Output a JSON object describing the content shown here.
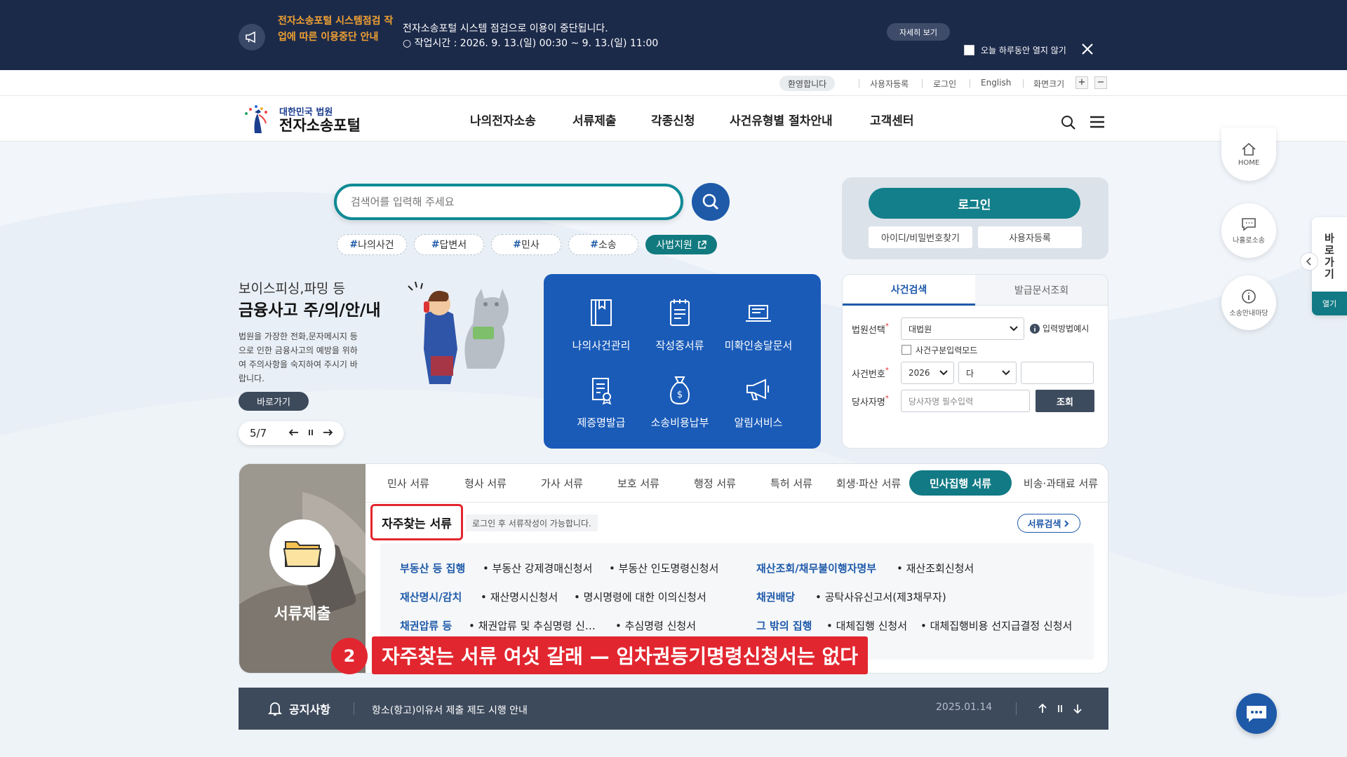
{
  "notice_bar": {
    "title": "전자소송포털 시스템점검 작업에 따른 이용중단 안내",
    "message_line1": "전자소송포털 시스템 점검으로 이용이 중단됩니다.",
    "message_line2": "○ 작업시간 : 2026. 9. 13.(일) 00:30 ~ 9. 13.(일) 11:00",
    "detail_button": "자세히 보기",
    "hide_today_label": "오늘 하루동안 열지 않기"
  },
  "util_bar": {
    "welcome": "환영합니다",
    "links": [
      "사용자등록",
      "로그인",
      "English"
    ],
    "screen_size_label": "화면크기",
    "zoom_in": "+",
    "zoom_out": "−"
  },
  "header": {
    "logo_sub": "대한민국 법원",
    "logo_main": "전자소송포털",
    "nav": [
      "나의전자소송",
      "서류제출",
      "각종신청",
      "사건유형별 절차안내",
      "고객센터"
    ]
  },
  "search": {
    "placeholder": "검색어를 입력해 주세요",
    "tags": [
      "나의사건",
      "답변서",
      "민사",
      "소송"
    ],
    "tag_hash": "#",
    "judicial_button": "사법지원"
  },
  "login": {
    "button": "로그인",
    "find_button": "아이디/비밀번호찾기",
    "register_button": "사용자등록"
  },
  "banner": {
    "subtitle": "보이스피싱,파밍 등",
    "title": "금융사고 주/의/안/내",
    "description": "법원을 가장한 전화,문자메시지 등으로 인한 금융사고의 예방을 위하여 주의사항을 숙지하여 주시기 바랍니다.",
    "button": "바로가기",
    "pager": "5/7"
  },
  "quick_menu": [
    {
      "label": "나의사건관리",
      "icon": "book-icon"
    },
    {
      "label": "작성중서류",
      "icon": "notepad-icon"
    },
    {
      "label": "미확인송달문서",
      "icon": "laptop-icon"
    },
    {
      "label": "제증명발급",
      "icon": "certificate-icon"
    },
    {
      "label": "소송비용납부",
      "icon": "money-bag-icon"
    },
    {
      "label": "알림서비스",
      "icon": "megaphone-icon"
    }
  ],
  "case_search": {
    "tab_case": "사건검색",
    "tab_doc": "발급문서조회",
    "court_label": "법원선택",
    "court_value": "대법원",
    "input_method": "입력방법예시",
    "mode_label": "사건구분입력모드",
    "case_no_label": "사건번호",
    "year_value": "2026",
    "type_value": "다",
    "party_label": "당사자명",
    "party_placeholder": "당사자명 필수입력",
    "submit": "조회",
    "required_mark": "*"
  },
  "documents": {
    "side_label": "서류제출",
    "tabs": [
      "민사 서류",
      "형사 서류",
      "가사 서류",
      "보호 서류",
      "행정 서류",
      "특허 서류",
      "회생·파산 서류",
      "민사집행 서류",
      "비송·과태료 서류"
    ],
    "active_tab": "민사집행 서류",
    "favorites_title": "자주찾는 서류",
    "login_note": "로그인 후 서류작성이 가능합니다.",
    "search_button": "서류검색",
    "rows": [
      {
        "cat1": "부동산 등 집행",
        "items1": [
          "부동산 강제경매신청서",
          "부동산 인도명령신청서"
        ],
        "cat2": "재산조회/채무불이행자명부",
        "items2": [
          "재산조회신청서"
        ]
      },
      {
        "cat1": "재산명시/감치",
        "items1": [
          "재산명시신청서",
          "명시명령에 대한 이의신청서"
        ],
        "cat2": "채권배당",
        "items2": [
          "공탁사유신고서(제3채무자)"
        ]
      },
      {
        "cat1": "채권압류 등",
        "items1": [
          "채권압류 및 추심명령 신…",
          "추심명령 신청서"
        ],
        "cat2": "그 밖의 집행",
        "items2": [
          "대체집행 신청서",
          "대체집행비용 선지급결정 신청서"
        ]
      }
    ]
  },
  "annotation": {
    "number": "2",
    "text": "자주찾는 서류 여섯 갈래 — 임차권등기명령신청서는 없다"
  },
  "notice_strip": {
    "title": "공지사항",
    "text": "항소(항고)이유서 제출 제도 시행 안내",
    "date": "2025.01.14"
  },
  "right_quick": {
    "home": "HOME",
    "self_litigation": "나홀로소송",
    "guide": "소송안내마당",
    "side_tab": "바로가기",
    "side_open": "열기"
  },
  "colors": {
    "notice_bg": "#1c2a4a",
    "notice_title": "#f0a132",
    "primary_teal": "#117a85",
    "primary_blue": "#1a5bb8",
    "annotation_red": "#e2262f"
  }
}
